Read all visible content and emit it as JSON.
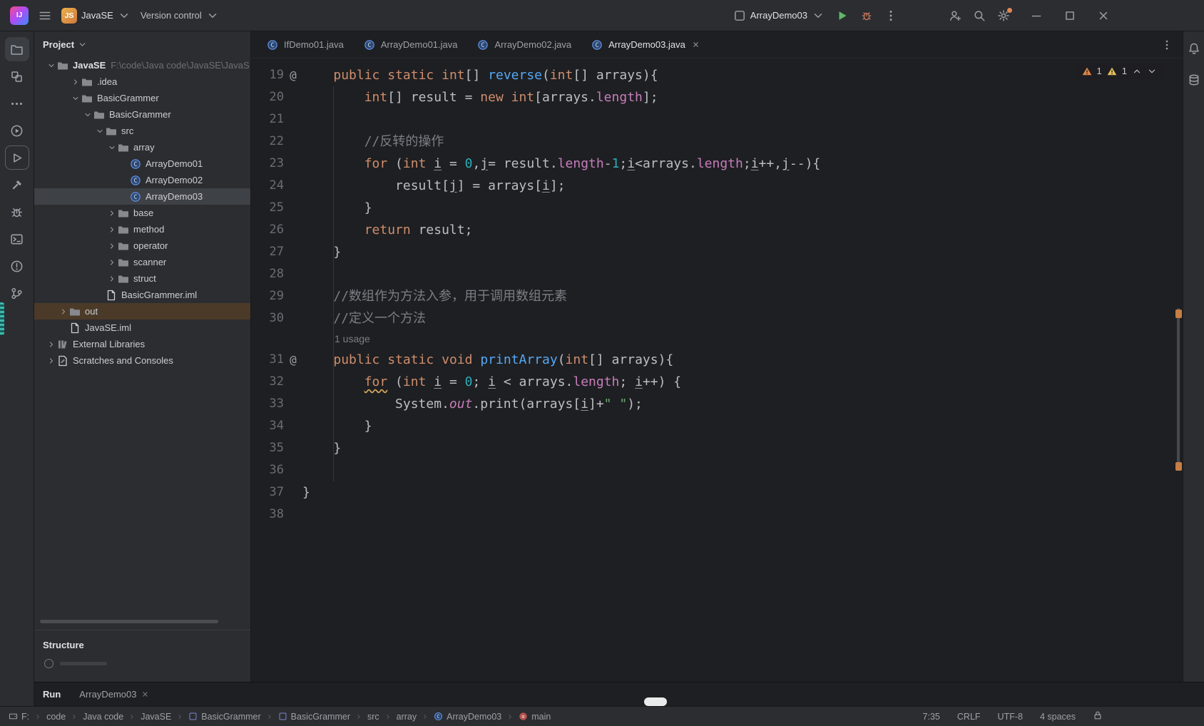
{
  "title_bar": {
    "logo_text": "IJ",
    "project_badge": "JS",
    "project_name": "JavaSE",
    "version_control_label": "Version control",
    "run_config": "ArrayDemo03"
  },
  "activity_bar": {
    "top": [
      {
        "name": "project",
        "active": true
      },
      {
        "name": "structure"
      },
      {
        "name": "more"
      }
    ],
    "bottom": [
      {
        "name": "services"
      },
      {
        "name": "run",
        "boxed": true
      },
      {
        "name": "build"
      },
      {
        "name": "debug"
      },
      {
        "name": "terminal"
      },
      {
        "name": "problems"
      },
      {
        "name": "git"
      }
    ]
  },
  "right_strip": {
    "icons": [
      "notifications",
      "database"
    ]
  },
  "project_panel": {
    "header": "Project",
    "structure_header": "Structure",
    "items": [
      {
        "label": "JavaSE",
        "path": "F:\\code\\Java code\\JavaSE\\JavaS",
        "depth": 0,
        "icon": "folder",
        "chevron": "open",
        "bold": true
      },
      {
        "label": ".idea",
        "depth": 2,
        "icon": "folder",
        "chevron": "closed"
      },
      {
        "label": "BasicGrammer",
        "depth": 2,
        "icon": "folder",
        "chevron": "open"
      },
      {
        "label": "BasicGrammer",
        "depth": 3,
        "icon": "folder",
        "chevron": "open"
      },
      {
        "label": "src",
        "depth": 4,
        "icon": "folder",
        "chevron": "open"
      },
      {
        "label": "array",
        "depth": 5,
        "icon": "folder",
        "chevron": "open"
      },
      {
        "label": "ArrayDemo01",
        "depth": 6,
        "icon": "class"
      },
      {
        "label": "ArrayDemo02",
        "depth": 6,
        "icon": "class"
      },
      {
        "label": "ArrayDemo03",
        "depth": 6,
        "icon": "class",
        "selected": true
      },
      {
        "label": "base",
        "depth": 5,
        "icon": "folder",
        "chevron": "closed"
      },
      {
        "label": "method",
        "depth": 5,
        "icon": "folder",
        "chevron": "closed"
      },
      {
        "label": "operator",
        "depth": 5,
        "icon": "folder",
        "chevron": "closed"
      },
      {
        "label": "scanner",
        "depth": 5,
        "icon": "folder",
        "chevron": "closed"
      },
      {
        "label": "struct",
        "depth": 5,
        "icon": "folder",
        "chevron": "closed"
      },
      {
        "label": "BasicGrammer.iml",
        "depth": 4,
        "icon": "file"
      },
      {
        "label": "out",
        "depth": 1,
        "icon": "folder",
        "chevron": "closed",
        "excluded": true
      },
      {
        "label": "JavaSE.iml",
        "depth": 1,
        "icon": "file"
      },
      {
        "label": "External Libraries",
        "depth": 0,
        "icon": "libraries",
        "chevron": "closed"
      },
      {
        "label": "Scratches and Consoles",
        "depth": 0,
        "icon": "scratches",
        "chevron": "closed"
      }
    ]
  },
  "editor_tabs": {
    "tabs": [
      {
        "label": "IfDemo01.java"
      },
      {
        "label": "ArrayDemo01.java"
      },
      {
        "label": "ArrayDemo02.java"
      },
      {
        "label": "ArrayDemo03.java",
        "active": true
      }
    ]
  },
  "editor": {
    "inspection": {
      "errors": "1",
      "warnings": "1"
    },
    "lines": [
      {
        "n": "19",
        "m": "@",
        "t": [
          [
            "p",
            "    "
          ],
          [
            "kw",
            "public"
          ],
          [
            "p",
            " "
          ],
          [
            "kw",
            "static"
          ],
          [
            "p",
            " "
          ],
          [
            "kw",
            "int"
          ],
          [
            "p",
            "[] "
          ],
          [
            "fn",
            "reverse"
          ],
          [
            "p",
            "("
          ],
          [
            "kw",
            "int"
          ],
          [
            "p",
            "[] arrays){"
          ]
        ]
      },
      {
        "n": "20",
        "t": [
          [
            "p",
            "        "
          ],
          [
            "kw",
            "int"
          ],
          [
            "p",
            "[] result = "
          ],
          [
            "kw",
            "new"
          ],
          [
            "p",
            " "
          ],
          [
            "kw",
            "int"
          ],
          [
            "p",
            "[arrays."
          ],
          [
            "fld",
            "length"
          ],
          [
            "p",
            "];"
          ]
        ]
      },
      {
        "n": "21",
        "t": []
      },
      {
        "n": "22",
        "t": [
          [
            "p",
            "        "
          ],
          [
            "cmt",
            "//反转的操作"
          ]
        ]
      },
      {
        "n": "23",
        "t": [
          [
            "p",
            "        "
          ],
          [
            "kw",
            "for"
          ],
          [
            "p",
            " ("
          ],
          [
            "kw",
            "int"
          ],
          [
            "p",
            " "
          ],
          [
            "pu",
            "i"
          ],
          [
            "p",
            " = "
          ],
          [
            "num",
            "0"
          ],
          [
            "p",
            ","
          ],
          [
            "pu",
            "j"
          ],
          [
            "p",
            "= result."
          ],
          [
            "fld",
            "length"
          ],
          [
            "p",
            "-"
          ],
          [
            "num",
            "1"
          ],
          [
            "p",
            ";"
          ],
          [
            "pu",
            "i"
          ],
          [
            "p",
            "<arrays."
          ],
          [
            "fld",
            "length"
          ],
          [
            "p",
            ";"
          ],
          [
            "pu",
            "i"
          ],
          [
            "p",
            "++,"
          ],
          [
            "pu",
            "j"
          ],
          [
            "p",
            "--){"
          ]
        ]
      },
      {
        "n": "24",
        "t": [
          [
            "p",
            "            result["
          ],
          [
            "pu",
            "j"
          ],
          [
            "p",
            "] = arrays["
          ],
          [
            "pu",
            "i"
          ],
          [
            "p",
            "];"
          ]
        ]
      },
      {
        "n": "25",
        "t": [
          [
            "p",
            "        }"
          ]
        ]
      },
      {
        "n": "26",
        "t": [
          [
            "p",
            "        "
          ],
          [
            "kw",
            "return"
          ],
          [
            "p",
            " result;"
          ]
        ]
      },
      {
        "n": "27",
        "t": [
          [
            "p",
            "    }"
          ]
        ]
      },
      {
        "n": "28",
        "t": []
      },
      {
        "n": "29",
        "t": [
          [
            "p",
            "    "
          ],
          [
            "cmt",
            "//数组作为方法入参，用于调用数组元素"
          ]
        ]
      },
      {
        "n": "30",
        "t": [
          [
            "p",
            "    "
          ],
          [
            "cmt",
            "//定义一个方法"
          ]
        ]
      },
      {
        "inlay": "1 usage"
      },
      {
        "n": "31",
        "m": "@",
        "t": [
          [
            "p",
            "    "
          ],
          [
            "kw",
            "public"
          ],
          [
            "p",
            " "
          ],
          [
            "kw",
            "static"
          ],
          [
            "p",
            " "
          ],
          [
            "kw",
            "void"
          ],
          [
            "p",
            " "
          ],
          [
            "fn",
            "printArray"
          ],
          [
            "p",
            "("
          ],
          [
            "kw",
            "int"
          ],
          [
            "p",
            "[] arrays){"
          ]
        ]
      },
      {
        "n": "32",
        "t": [
          [
            "p",
            "        "
          ],
          [
            "kww",
            "for"
          ],
          [
            "p",
            " ("
          ],
          [
            "kw",
            "int"
          ],
          [
            "p",
            " "
          ],
          [
            "pu",
            "i"
          ],
          [
            "p",
            " = "
          ],
          [
            "num",
            "0"
          ],
          [
            "p",
            "; "
          ],
          [
            "pu",
            "i"
          ],
          [
            "p",
            " < arrays."
          ],
          [
            "fld",
            "length"
          ],
          [
            "p",
            "; "
          ],
          [
            "pu",
            "i"
          ],
          [
            "p",
            "++) {"
          ]
        ]
      },
      {
        "n": "33",
        "t": [
          [
            "p",
            "            System."
          ],
          [
            "fldi",
            "out"
          ],
          [
            "p",
            ".print(arrays["
          ],
          [
            "pu",
            "i"
          ],
          [
            "p",
            "]+"
          ],
          [
            "str",
            "\" \""
          ],
          [
            "p",
            ");"
          ]
        ]
      },
      {
        "n": "34",
        "t": [
          [
            "p",
            "        }"
          ]
        ]
      },
      {
        "n": "35",
        "t": [
          [
            "p",
            "    }"
          ]
        ]
      },
      {
        "n": "36",
        "t": []
      },
      {
        "n": "37",
        "t": [
          [
            "p",
            "}"
          ]
        ]
      },
      {
        "n": "38",
        "t": []
      }
    ]
  },
  "run_panel": {
    "title": "Run",
    "tab_label": "ArrayDemo03"
  },
  "status_bar": {
    "breadcrumbs": [
      {
        "label": "F:",
        "icon": "drive"
      },
      {
        "label": "code"
      },
      {
        "label": "Java code"
      },
      {
        "label": "JavaSE"
      },
      {
        "label": "BasicGrammer",
        "icon": "module"
      },
      {
        "label": "BasicGrammer",
        "icon": "module"
      },
      {
        "label": "src"
      },
      {
        "label": "array"
      },
      {
        "label": "ArrayDemo03",
        "icon": "class"
      },
      {
        "label": "main",
        "icon": "main"
      }
    ],
    "caret": "7:35",
    "line_separator": "CRLF",
    "encoding": "UTF-8",
    "indent": "4 spaces"
  },
  "colors": {
    "run_green": "#5FB865",
    "warning_yellow": "#E5BE58",
    "error_orange": "#E08547",
    "excluded_row": "#4B3A28",
    "selection_gray": "#3E4145",
    "settings_badge": "#E08855",
    "keyword": "#CF8E6D",
    "method": "#56A8F5",
    "string": "#6AAB73",
    "number": "#2AACB8",
    "comment": "#7A7E85",
    "field": "#C77DBB"
  }
}
